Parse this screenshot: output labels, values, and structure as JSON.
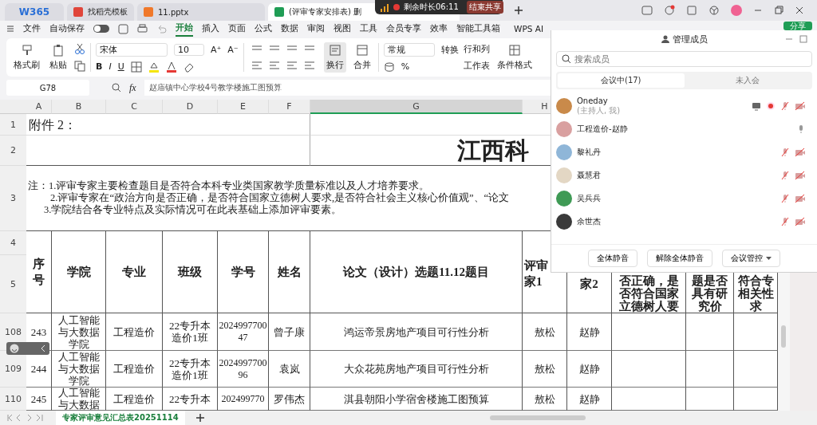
{
  "browser": {
    "logo": "W365",
    "tabs": [
      {
        "label": "找稻壳模板",
        "color": "#e0453a",
        "selected": false
      },
      {
        "label": "11.pptx",
        "color": "#f0782a",
        "selected": false
      },
      {
        "label": "(评审专家安排表) 删",
        "color": "#1f9d55",
        "selected": true
      }
    ]
  },
  "share_bar": {
    "remaining": "剩余时长06:11",
    "stop": "结束共享"
  },
  "menu": {
    "file": "文件",
    "autosave": {
      "label": "自动保存",
      "on": false
    },
    "tabs": [
      {
        "label": "开始",
        "selected": true
      },
      {
        "label": "插入",
        "selected": false
      },
      {
        "label": "页面",
        "selected": false
      },
      {
        "label": "公式",
        "selected": false
      },
      {
        "label": "数据",
        "selected": false
      },
      {
        "label": "审阅",
        "selected": false
      },
      {
        "label": "视图",
        "selected": false
      },
      {
        "label": "工具",
        "selected": false
      },
      {
        "label": "会员专享",
        "selected": false
      },
      {
        "label": "效率",
        "selected": false
      },
      {
        "label": "智能工具箱",
        "selected": false
      }
    ],
    "ai": "WPS AI",
    "share": "分享"
  },
  "ribbon": {
    "format_painter": "格式刷",
    "paste": "粘贴",
    "font": "宋体",
    "size": "10",
    "grow": "A⁺",
    "shrink": "A⁻",
    "styles": [
      "B",
      "I",
      "U"
    ],
    "wrap": "换行",
    "merge": "合并",
    "number_format": "常规",
    "percent": "%",
    "convert": "转换",
    "rows_cols": "行和列",
    "worksheet": "工作表",
    "conditional": "条件格式"
  },
  "formula_bar": {
    "cell": "G78",
    "fx": "fx",
    "value": "赵庙镇中心学校4号教学楼施工图预算"
  },
  "sheet": {
    "columns": [
      {
        "label": "A",
        "selected": false
      },
      {
        "label": "B",
        "selected": false
      },
      {
        "label": "C",
        "selected": false
      },
      {
        "label": "D",
        "selected": false
      },
      {
        "label": "E",
        "selected": false
      },
      {
        "label": "F",
        "selected": false
      },
      {
        "label": "G",
        "selected": true
      },
      {
        "label": "H",
        "selected": false
      }
    ],
    "row_numbers": [
      "1",
      "2",
      "3"
    ],
    "attachment": "附件 2：",
    "title": "江西科",
    "notes": [
      "注：1.评审专家主要检查题目是否符合本科专业类国家教学质量标准以及人才培养要求。",
      "2.评审专家在“政治方向是否正确，是否符合国家立德树人要求,是否符合社会主义核心价值观”、“论文",
      "3.学院结合各专业特点及实际情况可在此表基础上添加评审要素。"
    ],
    "header_rows": [
      "4",
      "5"
    ],
    "headers": [
      "序号",
      "学院",
      "专业",
      "班级",
      "学号",
      "姓名",
      "论文（设计）选题11.12题目",
      "评审家1",
      "家2",
      "否正确，是否符合国家立德树人要",
      "题是否具有研究价",
      "符合专相关性求"
    ],
    "rows": [
      {
        "row": "108",
        "cells": [
          "243",
          "人工智能与大数据学院",
          "工程造价",
          "22专升本造价1班",
          "202499770047",
          "曾子康",
          "鸿运帝景房地产项目可行性分析",
          "敖松",
          "赵静"
        ]
      },
      {
        "row": "109",
        "cells": [
          "244",
          "人工智能与大数据学院",
          "工程造价",
          "22专升本造价1班",
          "202499770096",
          "袁岚",
          "大众花苑房地产项目可行性分析",
          "敖松",
          "赵静"
        ]
      },
      {
        "row": "110",
        "cells": [
          "245",
          "人工智能与大数据",
          "工程造价",
          "22专升本",
          "202499770",
          "罗伟杰",
          "淇县朝阳小学宿舍楼施工图预算",
          "敖松",
          "赵静"
        ]
      }
    ],
    "sheet_tab": "专家评审意见汇总表20251114"
  },
  "panel": {
    "title": "管理成员",
    "search": {
      "placeholder": "搜索成员"
    },
    "tabs": [
      {
        "label": "会议中(17)",
        "selected": true
      },
      {
        "label": "未入会",
        "selected": false
      }
    ],
    "members": [
      {
        "name": "Oneday",
        "role": "(主持人, 我)",
        "sharing": true,
        "muted": true,
        "camera_off": true
      },
      {
        "name": "工程造价-赵静",
        "sharing": false,
        "muted": false,
        "camera_off": false
      },
      {
        "name": "黎礼丹",
        "sharing": false,
        "muted": true,
        "camera_off": true
      },
      {
        "name": "聂慧君",
        "sharing": false,
        "muted": true,
        "camera_off": true
      },
      {
        "name": "吴兵兵",
        "sharing": false,
        "muted": true,
        "camera_off": true
      },
      {
        "name": "余世杰",
        "sharing": false,
        "muted": true,
        "camera_off": true
      }
    ],
    "buttons": [
      "全体静音",
      "解除全体静音",
      "会议管控"
    ]
  }
}
